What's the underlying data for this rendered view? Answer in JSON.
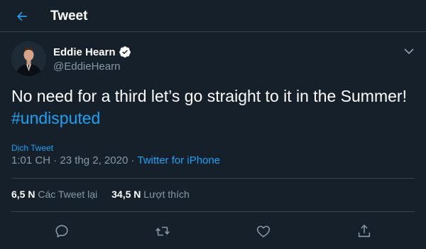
{
  "header": {
    "title": "Tweet",
    "back_icon": "arrow-left-icon"
  },
  "tweet": {
    "author": {
      "name": "Eddie Hearn",
      "handle": "@EddieHearn",
      "verified": true
    },
    "text": "No need for a third let’s go straight to it in the Summer!",
    "hashtag": "#undisputed",
    "translate_label": "Dịch Tweet",
    "time": "1:01 CH",
    "date": "23 thg 2, 2020",
    "separator": " · ",
    "source": "Twitter for iPhone",
    "stats": {
      "retweets_count": "6,5 N",
      "retweets_label": "Các Tweet lại",
      "likes_count": "34,5 N",
      "likes_label": "Lượt thích"
    }
  },
  "actions": [
    {
      "name": "reply",
      "icon": "reply-icon"
    },
    {
      "name": "retweet",
      "icon": "retweet-icon"
    },
    {
      "name": "like",
      "icon": "heart-icon"
    },
    {
      "name": "share",
      "icon": "share-icon"
    }
  ],
  "colors": {
    "background": "#15202b",
    "accent": "#1da1f2",
    "secondary_text": "#8899a6",
    "divider": "#38444d"
  }
}
